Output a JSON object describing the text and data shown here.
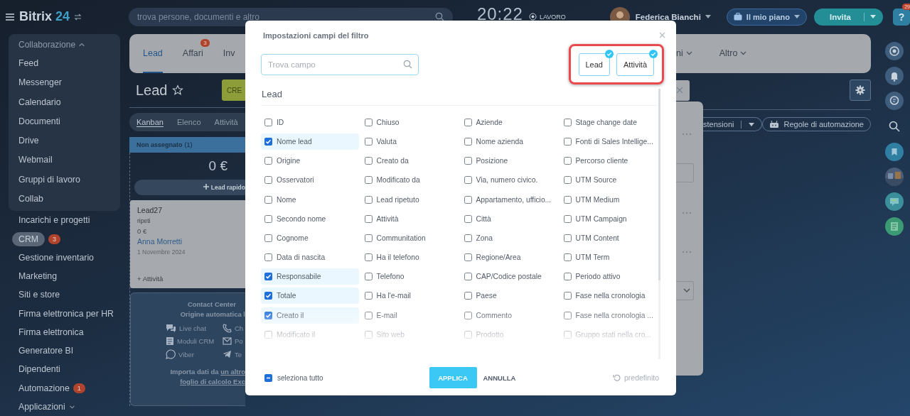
{
  "header": {
    "logo": "Bitrix",
    "logo_num": "24",
    "search": {
      "placeholder": "trova persone, documenti e altro"
    },
    "clock": "20:22",
    "status": "LAVORO",
    "user": "Federica Bianchi",
    "plan_button": "Il mio piano",
    "invite_button": "Invita",
    "help_label": "?",
    "help_badge": "29"
  },
  "sidebar": {
    "group": {
      "title": "Collaborazione",
      "expanded": true,
      "items": [
        "Feed",
        "Messenger",
        "Calendario",
        "Documenti",
        "Drive",
        "Webmail",
        "Gruppi di lavoro",
        "Collab"
      ]
    },
    "items": [
      {
        "label": "Incarichi e progetti",
        "selected": false
      },
      {
        "label": "CRM",
        "selected": true,
        "badge": "3"
      },
      {
        "label": "Gestione inventario",
        "selected": false
      },
      {
        "label": "Marketing",
        "selected": false
      },
      {
        "label": "Siti e store",
        "selected": false
      },
      {
        "label": "Firma elettronica per HR",
        "selected": false
      },
      {
        "label": "Firma elettronica",
        "selected": false
      },
      {
        "label": "Generatore BI",
        "selected": false
      },
      {
        "label": "Dipendenti",
        "selected": false
      },
      {
        "label": "Automazione",
        "selected": false,
        "badge": "1"
      },
      {
        "label": "Applicazioni",
        "selected": false,
        "expanded": false
      }
    ]
  },
  "tabs": [
    {
      "label": "Lead",
      "selected": true
    },
    {
      "label": "Affari",
      "selected": false,
      "badge": "3"
    },
    {
      "label": "Inv",
      "selected": false
    }
  ],
  "more_tabs": [
    {
      "label": "ni",
      "selected": false
    },
    {
      "label": "Altro",
      "selected": false
    }
  ],
  "page_title": "Lead",
  "create_button": "CRE",
  "views": [
    {
      "label": "Kanban",
      "selected": true
    },
    {
      "label": "Elenco",
      "selected": false
    },
    {
      "label": "Attività",
      "selected": false
    }
  ],
  "kanban": {
    "column": {
      "title": "Non assegnato",
      "count": "(1)",
      "total": "0 €",
      "quick_add": "Lead rapido"
    },
    "card": {
      "title": "Lead27",
      "subtitle": "ripeti",
      "amount": "0 €",
      "contact": "Anna Morretti",
      "date": "1 Novembre 2024",
      "add_activity": "+ Attività"
    },
    "contact_center": {
      "title": "Contact Center",
      "subtitle": "Origine automatica l",
      "channels": [
        {
          "label": "Live chat",
          "kind": "chat"
        },
        {
          "label": "Ch",
          "kind": "phone"
        },
        {
          "label": "Moduli CRM",
          "kind": "form"
        },
        {
          "label": "Po",
          "kind": "mail"
        },
        {
          "label": "Viber",
          "kind": "viber"
        },
        {
          "label": "Te",
          "kind": "telegram"
        }
      ],
      "import_text": "Importa dati da",
      "import_link": "un altro",
      "import_link_2": "foglio di calcolo Exc"
    }
  },
  "toolbar": {
    "extensions_button": "stensioni",
    "automation_button": "Regole di automazione"
  },
  "dialog": {
    "title": "Impostazioni campi del filtro",
    "search": {
      "placeholder": "Trova campo"
    },
    "entities": {
      "highlighted": true,
      "items": [
        {
          "label": "Lead",
          "selected": true
        },
        {
          "label": "Attività",
          "selected": true
        }
      ]
    },
    "section": "Lead",
    "fields": [
      {
        "label": "ID",
        "checked": false
      },
      {
        "label": "Chiuso",
        "checked": false
      },
      {
        "label": "Aziende",
        "checked": false
      },
      {
        "label": "Stage change date",
        "checked": false
      },
      {
        "label": "Nome lead",
        "checked": true
      },
      {
        "label": "Valuta",
        "checked": false
      },
      {
        "label": "Nome azienda",
        "checked": false
      },
      {
        "label": "Fonti di Sales Intellige...",
        "checked": false
      },
      {
        "label": "Origine",
        "checked": false
      },
      {
        "label": "Creato da",
        "checked": false
      },
      {
        "label": "Posizione",
        "checked": false
      },
      {
        "label": "Percorso cliente",
        "checked": false
      },
      {
        "label": "Osservatori",
        "checked": false
      },
      {
        "label": "Modificato da",
        "checked": false
      },
      {
        "label": "Via, numero civico.",
        "checked": false
      },
      {
        "label": "UTM Source",
        "checked": false
      },
      {
        "label": "Nome",
        "checked": false
      },
      {
        "label": "Lead ripetuto",
        "checked": false
      },
      {
        "label": "Appartamento, ufficio...",
        "checked": false
      },
      {
        "label": "UTM Medium",
        "checked": false
      },
      {
        "label": "Secondo nome",
        "checked": false
      },
      {
        "label": "Attività",
        "checked": false
      },
      {
        "label": "Città",
        "checked": false
      },
      {
        "label": "UTM Campaign",
        "checked": false
      },
      {
        "label": "Cognome",
        "checked": false
      },
      {
        "label": "Communitation",
        "checked": false
      },
      {
        "label": "Zona",
        "checked": false
      },
      {
        "label": "UTM Content",
        "checked": false
      },
      {
        "label": "Data di nascita",
        "checked": false
      },
      {
        "label": "Ha il telefono",
        "checked": false
      },
      {
        "label": "Regione/Area",
        "checked": false
      },
      {
        "label": "UTM Term",
        "checked": false
      },
      {
        "label": "Responsabile",
        "checked": true
      },
      {
        "label": "Telefono",
        "checked": false
      },
      {
        "label": "CAP/Codice postale",
        "checked": false
      },
      {
        "label": "Periodo attivo",
        "checked": false
      },
      {
        "label": "Totale",
        "checked": true
      },
      {
        "label": "Ha l'e-mail",
        "checked": false
      },
      {
        "label": "Paese",
        "checked": false
      },
      {
        "label": "Fase nella cronologia",
        "checked": false
      },
      {
        "label": "Creato il",
        "checked": true
      },
      {
        "label": "E-mail",
        "checked": false
      },
      {
        "label": "Commento",
        "checked": false
      },
      {
        "label": "Fase nella cronologia ...",
        "checked": false
      },
      {
        "label": "Modificato il",
        "checked": false
      },
      {
        "label": "Sito web",
        "checked": false
      },
      {
        "label": "Prodotto",
        "checked": false
      },
      {
        "label": "Gruppo stati nella cro...",
        "checked": false
      }
    ],
    "select_all": {
      "label": "seleziona tutto",
      "indeterminate": true
    },
    "apply_button": "APPLICA",
    "cancel_button": "ANNULLA",
    "reset_button": "predefinito"
  }
}
